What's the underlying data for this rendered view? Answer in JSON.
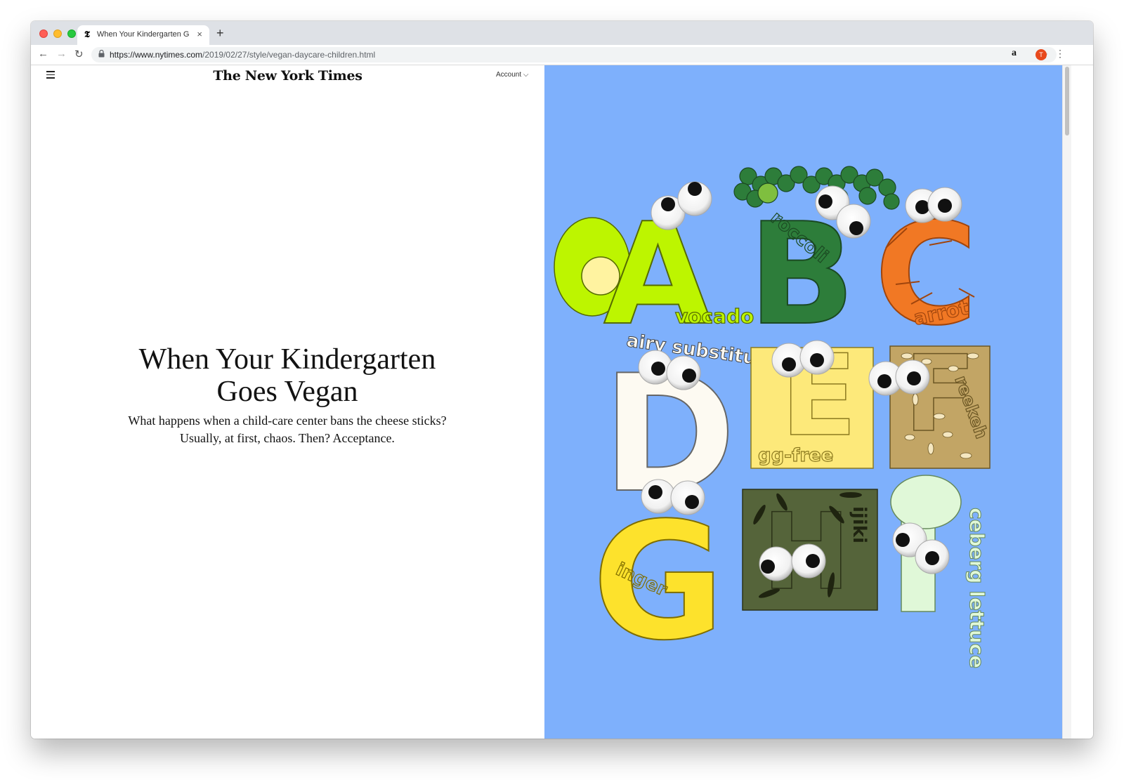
{
  "browser": {
    "tab_title": "When Your Kindergarten Goes",
    "tab_favicon": "𝕿",
    "close_glyph": "×",
    "new_tab_glyph": "+",
    "url_domain": "https://www.nytimes.com",
    "url_path": "/2019/02/27/style/vegan-daycare-children.html",
    "icons": {
      "back": "←",
      "forward": "→",
      "reload": "↻",
      "lock": "🔒",
      "star": "☆",
      "amazon": "a",
      "avatar": "T",
      "menu": "⋮"
    }
  },
  "nyt": {
    "masthead": "The New York Times",
    "account_label": "Account ⌵",
    "headline": "When Your Kindergarten Goes Vegan",
    "dek": "What happens when a child-care center bans the cheese sticks? Usually, at first, chaos. Then? Acceptance."
  },
  "illustration": {
    "bg_color": "#7eb0fc",
    "letters": {
      "A": {
        "letter": "A",
        "word": "vocado",
        "color": "#bdf500"
      },
      "B": {
        "letter": "B",
        "word": "roccoli",
        "color": "#2d7d3a"
      },
      "C": {
        "letter": "C",
        "word": "arrot",
        "color": "#f17824"
      },
      "D": {
        "letter": "D",
        "word": "airy substitutes",
        "color": "#fdfaf2"
      },
      "E": {
        "letter": "E",
        "word": "gg-free",
        "color": "#fde97a"
      },
      "F": {
        "letter": "F",
        "word": "reekeh",
        "color": "#c2a565"
      },
      "G": {
        "letter": "G",
        "word": "inger",
        "color": "#fde22c"
      },
      "H": {
        "letter": "H",
        "word": "ijiki",
        "color": "#55643a"
      },
      "I": {
        "letter": "I",
        "word": "ceberg lettuce",
        "color": "#e0f8d8"
      }
    }
  }
}
